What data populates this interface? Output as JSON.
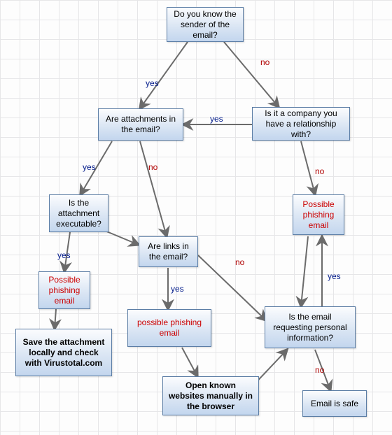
{
  "nodes": {
    "n1": "Do you know the sender of the email?",
    "n2": "Are attachments in the email?",
    "n3": "Is it a company you have a relationship with?",
    "n4": "Is the attachment executable?",
    "n5": "Are links in the email?",
    "n6": "Possible phishing email",
    "n7": "Possible phishing email",
    "n8": "possible phishing email",
    "n9": "Save the attachment locally and check with Virustotal.com",
    "n10": "Open known websites manually in the browser",
    "n11": "Is the email requesting personal information?",
    "n12": "Email is safe"
  },
  "labels": {
    "yes": "yes",
    "no": "no"
  },
  "chart_data": {
    "type": "flowchart",
    "nodes": [
      {
        "id": "n1",
        "text": "Do you know the sender of the email?"
      },
      {
        "id": "n2",
        "text": "Are attachments in the email?"
      },
      {
        "id": "n3",
        "text": "Is it a company you have a relationship with?"
      },
      {
        "id": "n4",
        "text": "Is the attachment executable?"
      },
      {
        "id": "n5",
        "text": "Are links in the email?"
      },
      {
        "id": "n6",
        "text": "Possible phishing email",
        "style": "warning"
      },
      {
        "id": "n7",
        "text": "Possible phishing email",
        "style": "warning"
      },
      {
        "id": "n8",
        "text": "possible phishing email",
        "style": "warning"
      },
      {
        "id": "n9",
        "text": "Save the attachment locally and check with Virustotal.com",
        "style": "bold"
      },
      {
        "id": "n10",
        "text": "Open known websites manually in the browser",
        "style": "bold"
      },
      {
        "id": "n11",
        "text": "Is the email requesting personal information?"
      },
      {
        "id": "n12",
        "text": "Email is safe"
      }
    ],
    "edges": [
      {
        "from": "n1",
        "to": "n2",
        "label": "yes"
      },
      {
        "from": "n1",
        "to": "n3",
        "label": "no"
      },
      {
        "from": "n3",
        "to": "n2",
        "label": "yes"
      },
      {
        "from": "n3",
        "to": "n6",
        "label": "no"
      },
      {
        "from": "n2",
        "to": "n4",
        "label": "yes"
      },
      {
        "from": "n2",
        "to": "n5",
        "label": "no"
      },
      {
        "from": "n4",
        "to": "n7",
        "label": "yes"
      },
      {
        "from": "n4",
        "to": "n5",
        "label": "no"
      },
      {
        "from": "n7",
        "to": "n9",
        "label": ""
      },
      {
        "from": "n5",
        "to": "n8",
        "label": "yes"
      },
      {
        "from": "n5",
        "to": "n11",
        "label": "no"
      },
      {
        "from": "n8",
        "to": "n10",
        "label": ""
      },
      {
        "from": "n10",
        "to": "n11",
        "label": ""
      },
      {
        "from": "n11",
        "to": "n6",
        "label": "yes"
      },
      {
        "from": "n6",
        "to": "n11",
        "label": ""
      },
      {
        "from": "n11",
        "to": "n12",
        "label": "no"
      }
    ]
  }
}
